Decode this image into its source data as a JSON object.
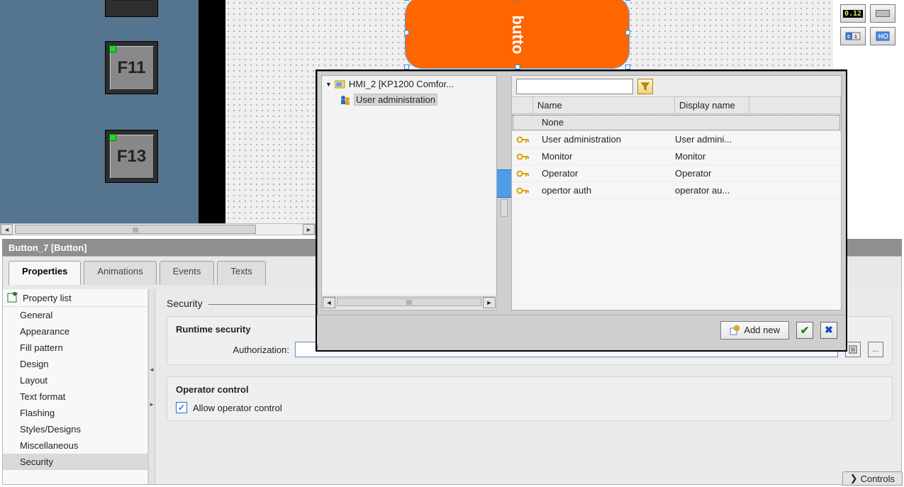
{
  "canvas": {
    "sim_buttons": {
      "f11": "F11",
      "f13": "F13"
    },
    "selected_element": "butto"
  },
  "inspector": {
    "title": "Button_7 [Button]",
    "tabs": {
      "properties": "Properties",
      "animations": "Animations",
      "events": "Events",
      "texts": "Texts"
    },
    "property_list_header": "Property list",
    "property_items": {
      "general": "General",
      "appearance": "Appearance",
      "fill": "Fill pattern",
      "design": "Design",
      "layout": "Layout",
      "textformat": "Text format",
      "flashing": "Flashing",
      "styles": "Styles/Designs",
      "misc": "Miscellaneous",
      "security": "Security"
    },
    "security_section": "Security",
    "runtime_group": "Runtime security",
    "auth_label": "Authorization:",
    "auth_value": "",
    "operator_group": "Operator control",
    "allow_op_label": "Allow operator control"
  },
  "popup": {
    "tree": {
      "root": "HMI_2 [KP1200 Comfor...",
      "child": "User administration"
    },
    "filter_value": "",
    "columns": {
      "name": "Name",
      "display": "Display name"
    },
    "rows": [
      {
        "icon": false,
        "name": "None",
        "display": ""
      },
      {
        "icon": true,
        "name": "User administration",
        "display": "User admini..."
      },
      {
        "icon": true,
        "name": "Monitor",
        "display": "Monitor"
      },
      {
        "icon": true,
        "name": "Operator",
        "display": "Operator"
      },
      {
        "icon": true,
        "name": "opertor auth",
        "display": "operator au..."
      }
    ],
    "add_new": "Add new"
  },
  "toolbox": {
    "lcd": "0.12"
  },
  "controls_tab": "Controls"
}
